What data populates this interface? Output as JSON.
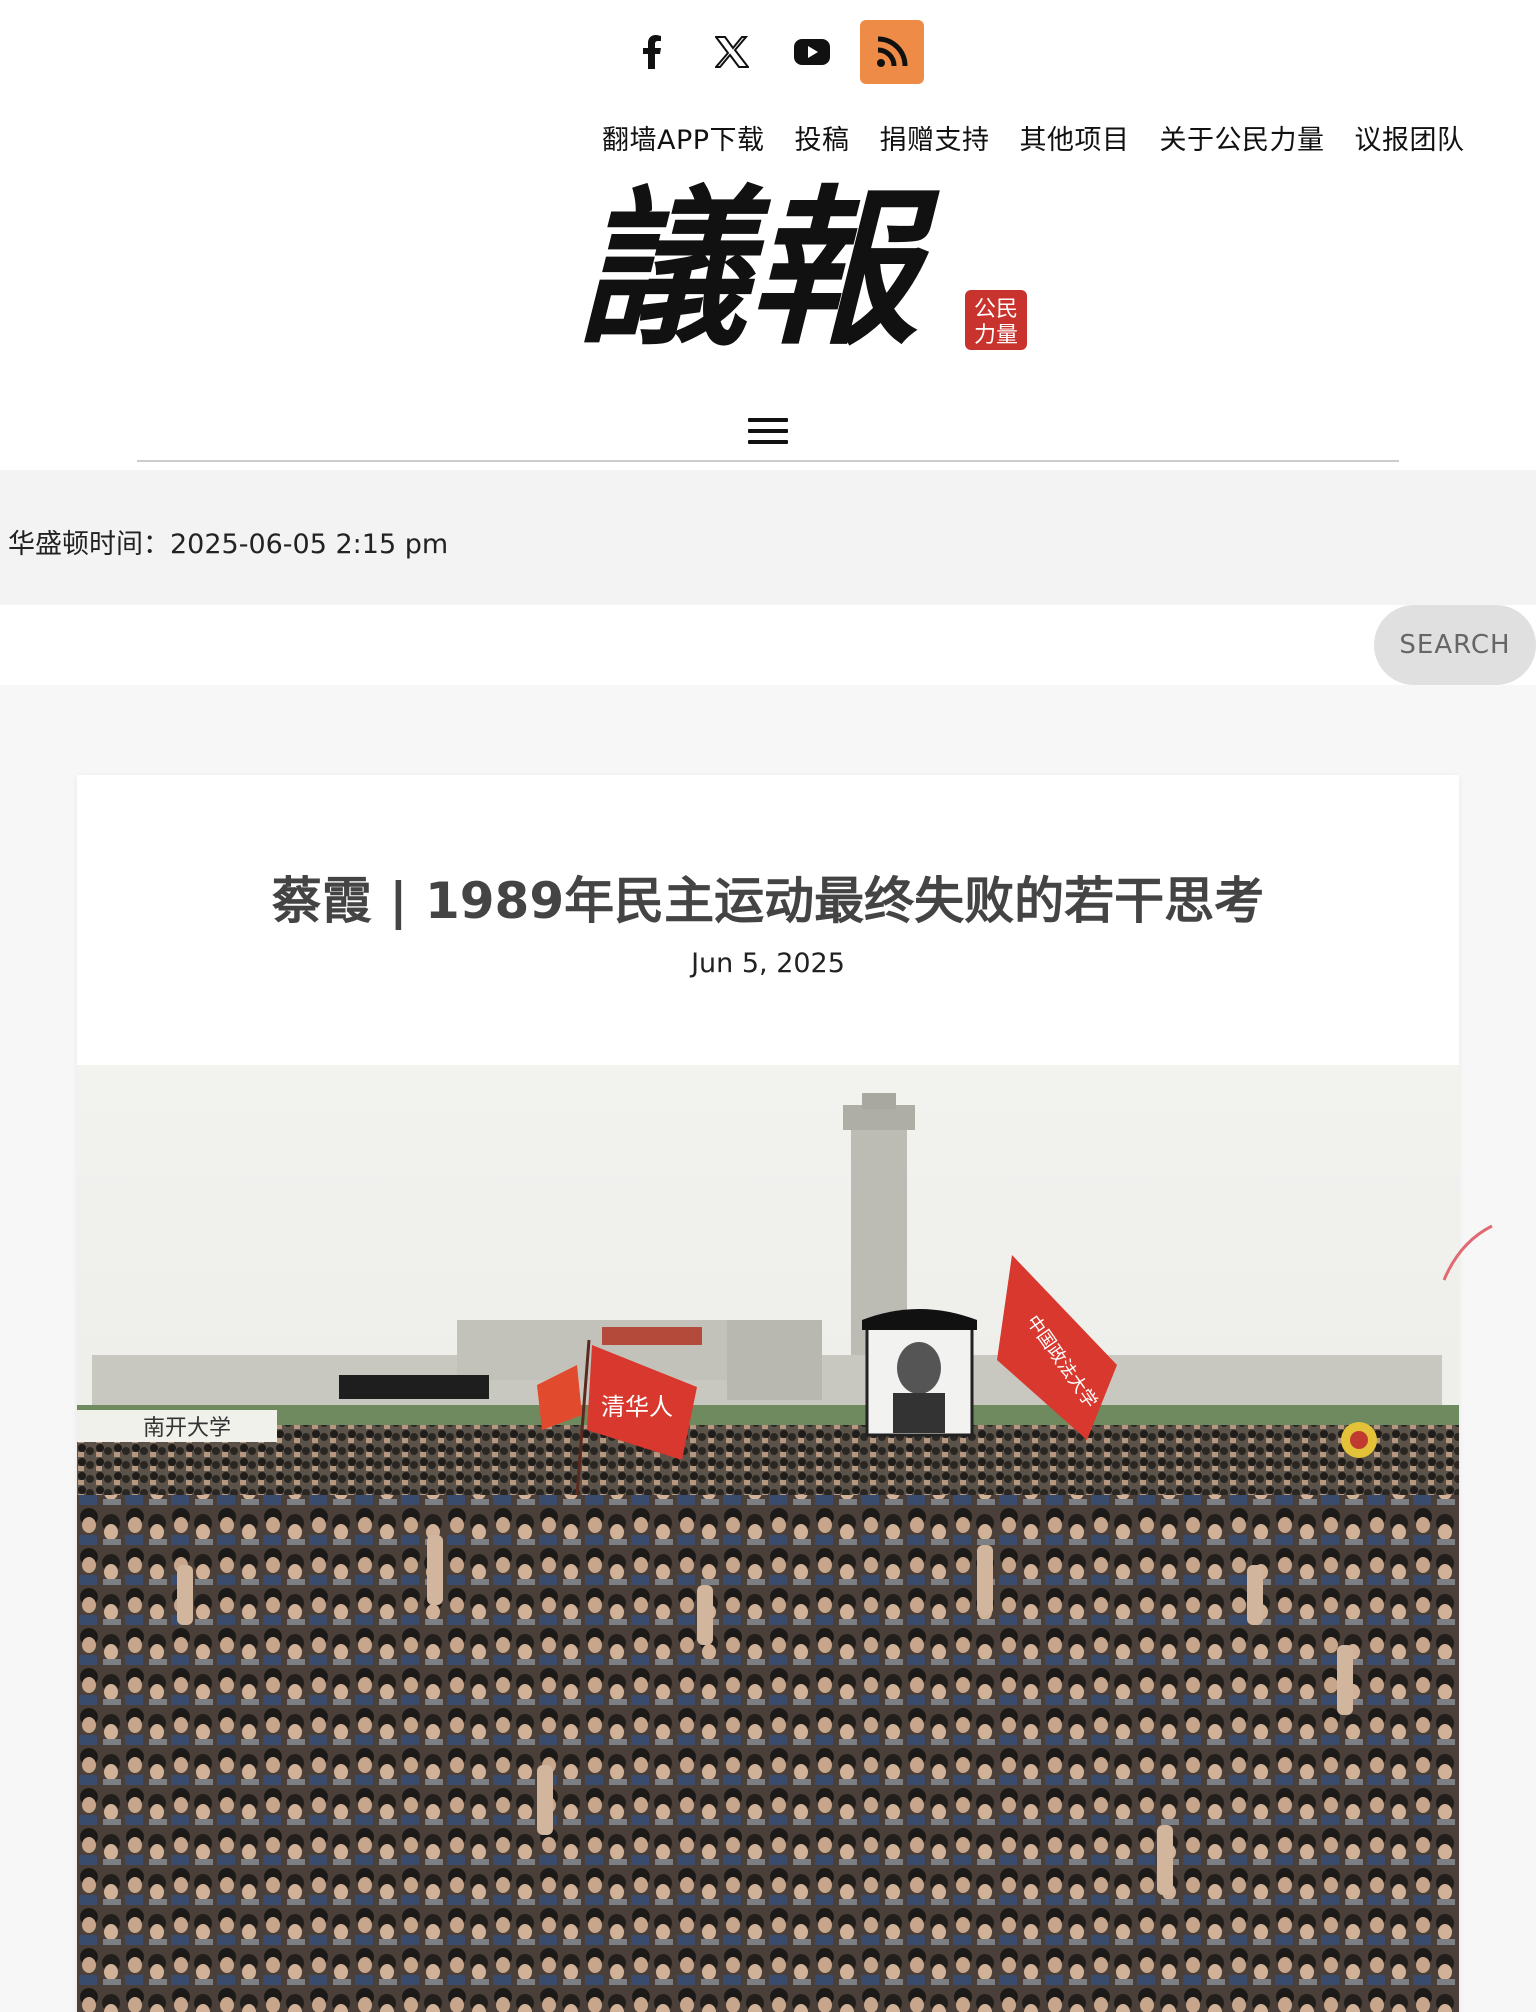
{
  "social": {
    "items": [
      {
        "name": "facebook",
        "icon": "facebook-icon"
      },
      {
        "name": "x",
        "icon": "x-icon"
      },
      {
        "name": "youtube",
        "icon": "youtube-icon"
      },
      {
        "name": "rss",
        "icon": "rss-icon",
        "color": "#ee8b46"
      }
    ]
  },
  "topnav": {
    "items": [
      "翻墙APP下载",
      "投稿",
      "捐赠支持",
      "其他项目",
      "关于公民力量",
      "议报团队"
    ]
  },
  "logo": {
    "text": "議報",
    "seal_lines": [
      "公民",
      "力量"
    ]
  },
  "timebar": {
    "label": "华盛顿时间：2025-06-05 2:15 pm"
  },
  "search": {
    "placeholder": "",
    "button_label": "SEARCH"
  },
  "article": {
    "title": "蔡霞 | 1989年民主运动最终失败的若干思考",
    "date": "Jun 5, 2025",
    "banners": [
      "清华人",
      "南开大学",
      "中国政法大学"
    ]
  },
  "colors": {
    "accent_rss": "#ee8b46",
    "seal_red": "#c9332d",
    "flag_red": "#d8382e"
  }
}
